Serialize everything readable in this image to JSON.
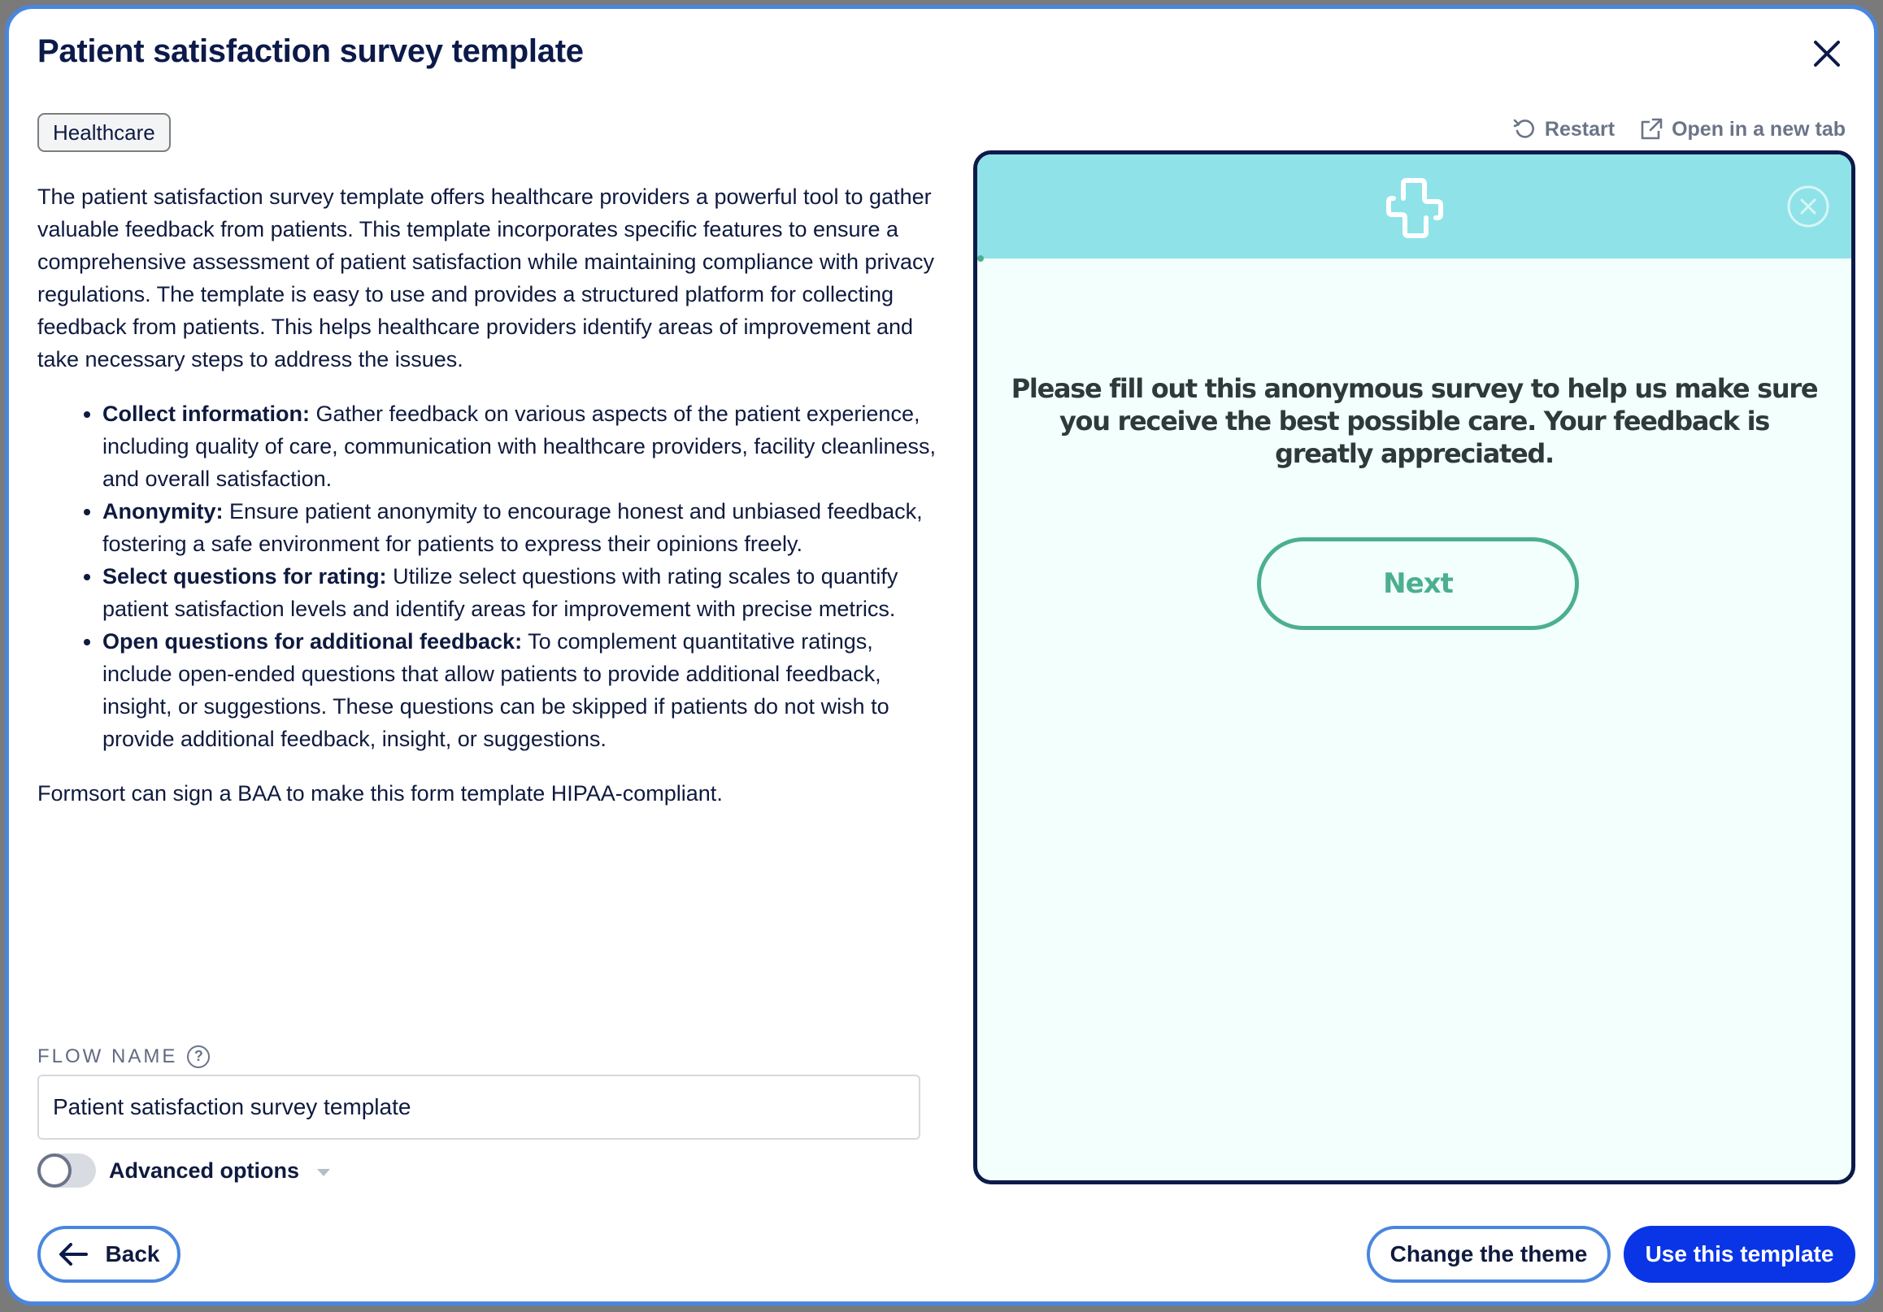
{
  "modal": {
    "title": "Patient satisfaction survey template",
    "close_icon": "close-icon"
  },
  "tag": "Healthcare",
  "description": {
    "intro": "The patient satisfaction survey template offers healthcare providers a powerful tool to gather valuable feedback from patients. This template incorporates specific features to ensure a comprehensive assessment of patient satisfaction while maintaining compliance with privacy regulations. The template is easy to use and provides a structured platform for collecting feedback from patients. This helps healthcare providers identify areas of improvement and take necessary steps to address the issues.",
    "features": [
      {
        "title": "Collect information:",
        "text": " Gather feedback on various aspects of the patient experience, including quality of care, communication with healthcare providers, facility cleanliness, and overall satisfaction."
      },
      {
        "title": "Anonymity:",
        "text": " Ensure patient anonymity to encourage honest and unbiased feedback, fostering a safe environment for patients to express their opinions freely."
      },
      {
        "title": "Select questions for rating:",
        "text": " Utilize select questions with rating scales to quantify patient satisfaction levels and identify areas for improvement with precise metrics."
      },
      {
        "title": "Open questions for additional feedback:",
        "text": " To complement quantitative ratings, include open-ended questions that allow patients to provide additional feedback, insight, or suggestions. These questions can be skipped if patients do not wish to provide additional feedback, insight, or suggestions."
      }
    ],
    "footer": "Formsort can sign a BAA to make this form template HIPAA-compliant."
  },
  "flow_name": {
    "label": "FLOW NAME",
    "help_icon": "?",
    "value": "Patient satisfaction survey template"
  },
  "advanced_options": {
    "label": "Advanced options",
    "enabled": false
  },
  "buttons": {
    "back": "Back",
    "change_theme": "Change the theme",
    "use_template": "Use this template"
  },
  "preview_actions": {
    "restart": "Restart",
    "open_new_tab": "Open in a new tab"
  },
  "preview": {
    "message": "Please fill out this anonymous survey to help us make sure you receive the best possible care. Your feedback is greatly appreciated.",
    "next_label": "Next",
    "progress": 0
  },
  "colors": {
    "primary": "#0a35e6",
    "outline": "#4a86e0",
    "text_dark": "#0c1a4a",
    "preview_header": "#8fe3e8",
    "preview_bg": "#f2fffd",
    "preview_accent": "#4caf8e"
  }
}
